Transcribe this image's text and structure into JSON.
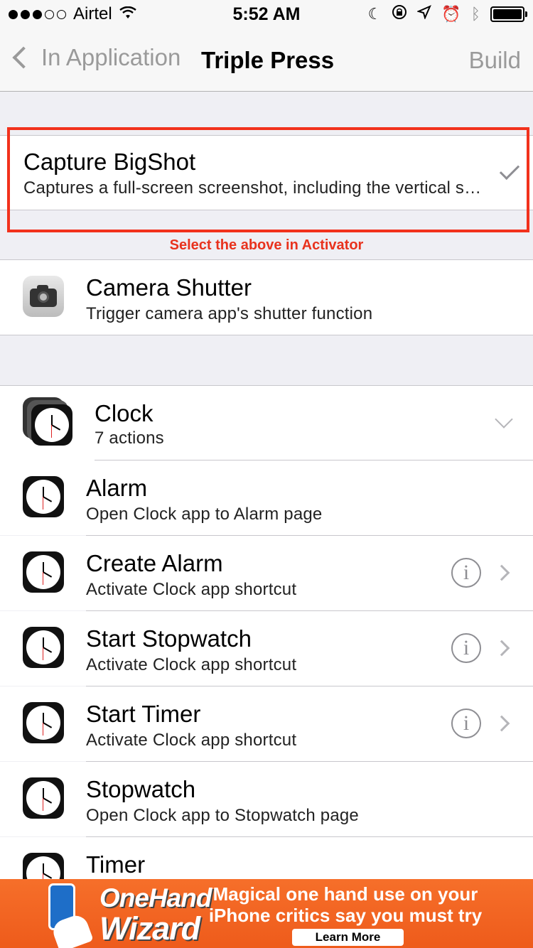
{
  "status_bar": {
    "carrier": "Airtel",
    "time": "5:52 AM",
    "signal_dots_filled": 3,
    "signal_dots_total": 5
  },
  "nav": {
    "back_label": "In Application",
    "title": "Triple Press",
    "right_label": "Build"
  },
  "selected_action": {
    "title": "Capture BigShot",
    "subtitle": "Captures a full-screen screenshot, including the vertical s…",
    "checked": true
  },
  "annotation_hint": "Select the above in Activator",
  "camera_action": {
    "title": "Camera Shutter",
    "subtitle": "Trigger camera app's shutter function"
  },
  "clock_group": {
    "title": "Clock",
    "subtitle": "7 actions",
    "items": [
      {
        "title": "Alarm",
        "subtitle": "Open Clock app to Alarm page"
      },
      {
        "title": "Create Alarm",
        "subtitle": "Activate Clock app shortcut"
      },
      {
        "title": "Start Stopwatch",
        "subtitle": "Activate Clock app shortcut"
      },
      {
        "title": "Start Timer",
        "subtitle": "Activate Clock app shortcut"
      },
      {
        "title": "Stopwatch",
        "subtitle": "Open Clock app to Stopwatch page"
      },
      {
        "title": "Timer",
        "subtitle": ""
      }
    ]
  },
  "ad": {
    "brand_line1": "OneHand",
    "brand_line2": "Wizard",
    "headline_line1": "Magical one hand use on your",
    "headline_line2": "iPhone critics say you must try",
    "cta": "Learn More"
  },
  "colors": {
    "highlight": "#f2311c",
    "ad_background": "#ee5b1b",
    "nav_tint": "#9a9a9a"
  }
}
